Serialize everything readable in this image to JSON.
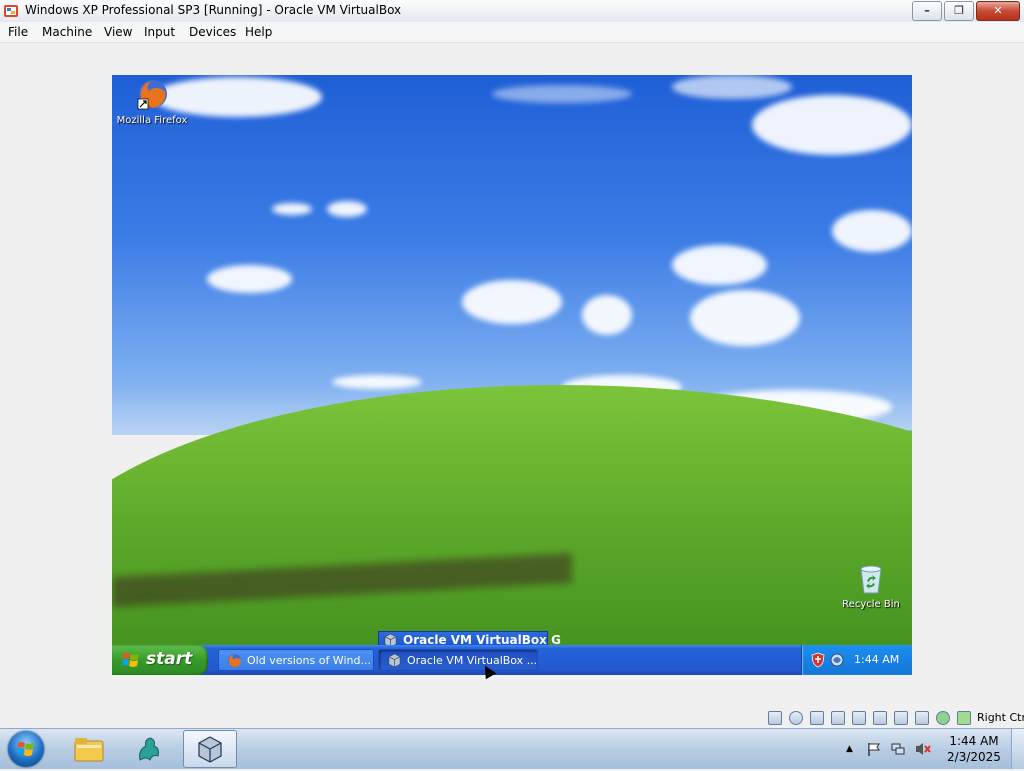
{
  "window": {
    "title": "Windows XP Professional SP3 [Running] - Oracle VM VirtualBox",
    "minimize_glyph": "–",
    "restore_glyph": "❐",
    "close_glyph": "✕"
  },
  "menu": [
    "File",
    "Machine",
    "View",
    "Input",
    "Devices",
    "Help"
  ],
  "guest": {
    "desktop_icons": [
      {
        "label": "Mozilla Firefox",
        "icon": "firefox-icon"
      },
      {
        "label": "Recycle Bin",
        "icon": "recycle-bin-icon"
      }
    ],
    "taskbar": {
      "start_label": "start",
      "grouped_popup_label": "Oracle VM VirtualBox G",
      "tasks": [
        {
          "label": "Old versions of Wind...",
          "icon": "firefox-icon"
        },
        {
          "label": "Oracle VM VirtualBox ...",
          "icon": "virtualbox-icon"
        }
      ],
      "clock": "1:44 AM"
    }
  },
  "statusbar": {
    "host_key_label": "Right Ctrl",
    "icons": [
      "hard-disk-icon",
      "optical-drive-icon",
      "audio-icon",
      "network-icon",
      "usb-icon",
      "shared-folders-icon",
      "display-icon",
      "video-capture-icon",
      "recording-icon",
      "cpu-icon",
      "mouse-integration-icon",
      "keyboard-icon"
    ]
  },
  "host_taskbar": {
    "pinned": [
      {
        "name": "file-explorer-icon"
      },
      {
        "name": "app-icon"
      },
      {
        "name": "virtualbox-icon"
      }
    ],
    "tray_arrow": "▲",
    "clock_time": "1:44 AM",
    "clock_date": "2/3/2025"
  },
  "colors": {
    "xp_taskbar_blue": "#2459d0",
    "xp_start_green": "#379a2c",
    "win7_taskbar": "#b9cde3"
  }
}
